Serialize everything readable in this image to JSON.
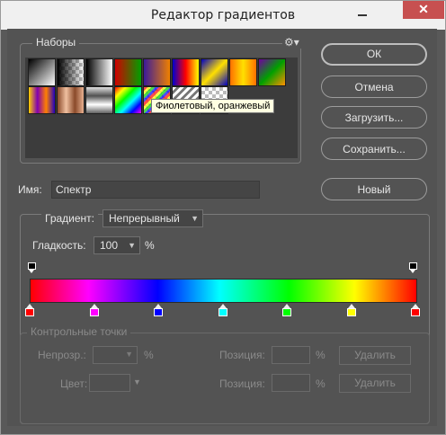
{
  "window": {
    "title": "Редактор градиентов",
    "minimize_glyph": "—",
    "close_glyph": "✕"
  },
  "presets": {
    "label": "Наборы",
    "menu_icon": "gear-icon",
    "gear_glyph": "⚙▾",
    "tooltip": "Фиолетовый, оранжевый",
    "swatches_row1": [
      {
        "name": "foreground-to-background",
        "bg": "linear-gradient(135deg,#000 0%,#fff 100%)"
      },
      {
        "name": "foreground-to-transparent",
        "bg": "checker-black"
      },
      {
        "name": "black-white",
        "bg": "linear-gradient(to right,#000,#fff)"
      },
      {
        "name": "red-green",
        "bg": "linear-gradient(to right,#d10000,#00a000)"
      },
      {
        "name": "violet-orange",
        "bg": "linear-gradient(to right,#3b1b9a,#f08000)"
      },
      {
        "name": "blue-red-yellow",
        "bg": "linear-gradient(to right,#0000d0,#ff0000,#ffff00)"
      },
      {
        "name": "blue-yellow-blue",
        "bg": "linear-gradient(135deg,#0000c0,#ffe000,#0000c0)"
      },
      {
        "name": "orange-yellow-orange",
        "bg": "linear-gradient(to right,#ff7000,#ffe000,#ff7000)"
      },
      {
        "name": "violet-green-orange",
        "bg": "linear-gradient(135deg,#7000a0,#00a000,#ff9000)"
      }
    ],
    "swatches_row2": [
      {
        "name": "yellow-violet-orange-blue",
        "bg": "linear-gradient(to right,#ffd000,#8000b0,#ff8000,#2000c0)"
      },
      {
        "name": "copper",
        "bg": "linear-gradient(to right,#8a4a2a,#f0c0a0,#8a4a2a,#e8b090)"
      },
      {
        "name": "chrome",
        "bg": "linear-gradient(to bottom,#e0e0e0,#505050,#fff,#606060)"
      },
      {
        "name": "spectrum",
        "bg": "linear-gradient(135deg,#ff0000,#ffff00,#00ff00,#00ffff,#0000ff,#ff00ff)"
      },
      {
        "name": "transparent-rainbow",
        "bg": "checker-rainbow"
      },
      {
        "name": "transparent-stripes",
        "bg": "checker-stripes"
      },
      {
        "name": "neutral-density",
        "bg": "checker"
      }
    ]
  },
  "buttons": {
    "ok": "ОК",
    "cancel": "Отмена",
    "load": "Загрузить...",
    "save": "Сохранить...",
    "new": "Новый"
  },
  "name_field": {
    "label": "Имя:",
    "value": "Спектр"
  },
  "gradient": {
    "type_label": "Градиент:",
    "type_value": "Непрерывный",
    "smoothness_label": "Гладкость:",
    "smoothness_value": "100",
    "smoothness_unit": "%",
    "color_stops": [
      "#ff0000",
      "#ff00ff",
      "#0000ff",
      "#00ffff",
      "#00ff00",
      "#ffff00",
      "#ff0000"
    ]
  },
  "control_points": {
    "title": "Контрольные точки",
    "opacity_label": "Непрозр.:",
    "opacity_unit": "%",
    "position_label": "Позиция:",
    "position_unit": "%",
    "delete_label": "Удалить",
    "color_label": "Цвет:"
  }
}
